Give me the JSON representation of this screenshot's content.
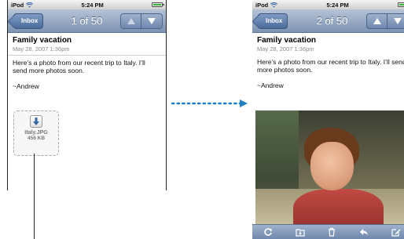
{
  "left_screen": {
    "status": {
      "carrier": "iPod",
      "time": "5:24 PM"
    },
    "nav": {
      "back_label": "Inbox",
      "counter": "1 of 50"
    },
    "message": {
      "subject": "Family vacation",
      "date": "May 28, 2007 1:36pm",
      "body_line1": "Here’s a photo from our recent trip to Italy. I’ll send more photos soon.",
      "signature": "~Andrew"
    },
    "attachment": {
      "filename": "Italy.JPG",
      "size": "456 KB"
    }
  },
  "right_screen": {
    "status": {
      "carrier": "iPod",
      "time": "5:24 PM"
    },
    "nav": {
      "back_label": "Inbox",
      "counter": "2 of 50"
    },
    "message": {
      "subject": "Family vacation",
      "date": "May 28, 2007 1:36pm",
      "body_line1": "Here’s a photo from our recent trip to Italy. I’ll send more photos soon.",
      "signature": "~Andrew"
    },
    "toolbar_icons": [
      "refresh-icon",
      "move-to-folder-icon",
      "trash-icon",
      "reply-icon",
      "compose-icon"
    ]
  },
  "colors": {
    "nav_blue": "#7d93b3",
    "connector": "#1f7fc4",
    "battery_green": "#3fb83a"
  }
}
